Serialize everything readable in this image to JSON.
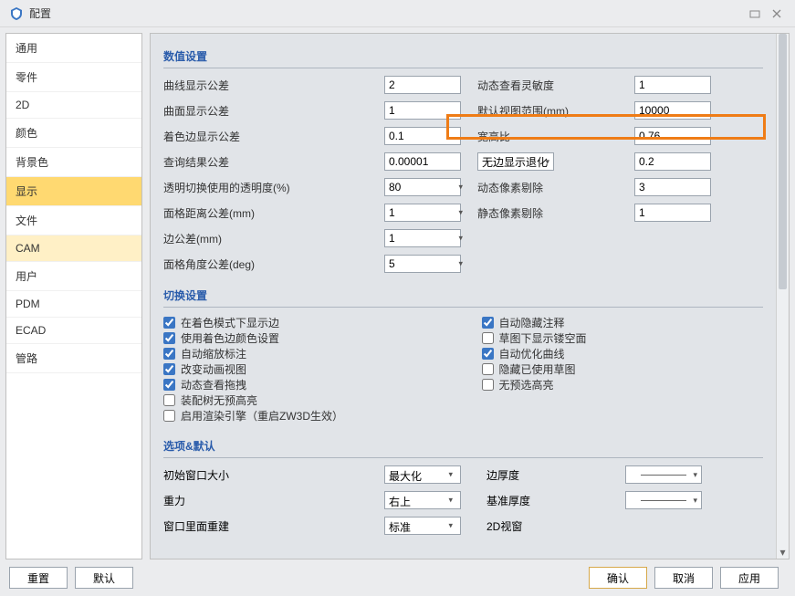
{
  "window": {
    "title": "配置"
  },
  "sidebar": {
    "items": [
      {
        "label": "通用"
      },
      {
        "label": "零件"
      },
      {
        "label": "2D"
      },
      {
        "label": "颜色"
      },
      {
        "label": "背景色"
      },
      {
        "label": "显示"
      },
      {
        "label": "文件"
      },
      {
        "label": "CAM"
      },
      {
        "label": "用户"
      },
      {
        "label": "PDM"
      },
      {
        "label": "ECAD"
      },
      {
        "label": "管路"
      }
    ],
    "active": "显示",
    "highlight": "CAM"
  },
  "sections": {
    "numeric": {
      "title": "数值设置",
      "rows": {
        "curve_tol_label": "曲线显示公差",
        "curve_tol": "2",
        "dyn_sens_label": "动态查看灵敏度",
        "dyn_sens": "1",
        "surface_tol_label": "曲面显示公差",
        "surface_tol": "1",
        "default_view_label": "默认视图范围(mm)",
        "default_view": "10000",
        "edge_tol_label": "着色边显示公差",
        "edge_tol": "0.1",
        "aspect_label": "宽高比",
        "aspect": "0.76",
        "query_tol_label": "查询结果公差",
        "query_tol": "0.00001",
        "noedge_label": "无边显示退化",
        "noedge_val": "0.2",
        "transparency_label": "透明切换使用的透明度(%)",
        "transparency": "80",
        "dyn_pixel_label": "动态像素剔除",
        "dyn_pixel": "3",
        "mesh_dist_label": "面格距离公差(mm)",
        "mesh_dist": "1",
        "static_pixel_label": "静态像素剔除",
        "static_pixel": "1",
        "edge_mm_label": "边公差(mm)",
        "edge_mm": "1",
        "mesh_angle_label": "面格角度公差(deg)",
        "mesh_angle": "5"
      }
    },
    "toggle": {
      "title": "切换设置",
      "left": [
        {
          "label": "在着色模式下显示边",
          "checked": true
        },
        {
          "label": "使用着色边颜色设置",
          "checked": true
        },
        {
          "label": "自动缩放标注",
          "checked": true
        },
        {
          "label": "改变动画视图",
          "checked": true
        },
        {
          "label": "动态查看拖拽",
          "checked": true
        },
        {
          "label": "装配树无预高亮",
          "checked": false
        },
        {
          "label": "启用渲染引擎（重启ZW3D生效）",
          "checked": false
        }
      ],
      "right": [
        {
          "label": "自动隐藏注释",
          "checked": true
        },
        {
          "label": "草图下显示镂空面",
          "checked": false
        },
        {
          "label": "自动优化曲线",
          "checked": true
        },
        {
          "label": "隐藏已使用草图",
          "checked": false
        },
        {
          "label": "无预选高亮",
          "checked": false
        }
      ]
    },
    "options": {
      "title": "选项&默认",
      "initial_window_label": "初始窗口大小",
      "initial_window": "最大化",
      "edge_thick_label": "边厚度",
      "gravity_label": "重力",
      "gravity": "右上",
      "base_thick_label": "基准厚度",
      "window_rebuild_label": "窗口里面重建",
      "window_rebuild": "标准",
      "view2d_label": "2D视窗"
    }
  },
  "footer": {
    "reset": "重置",
    "default": "默认",
    "ok": "确认",
    "cancel": "取消",
    "apply": "应用"
  }
}
